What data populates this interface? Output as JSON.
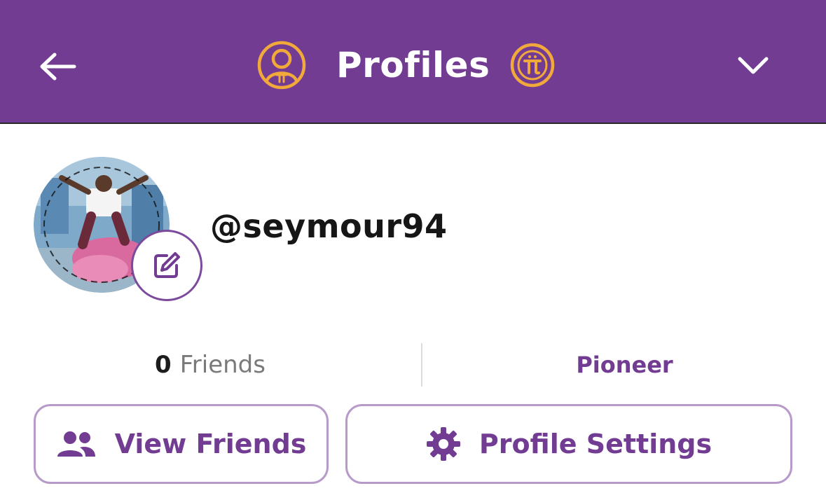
{
  "header": {
    "title": "Profiles",
    "background_color": "#713c92",
    "accent_color": "#f2a93b",
    "back_icon": "arrow-left-icon",
    "profile_icon": "profile-pi-icon",
    "coin_icon": "pi-coin-icon",
    "menu_icon": "chevron-down-icon"
  },
  "profile": {
    "username": "@seymour94",
    "avatar_icon": "avatar-image",
    "edit_icon": "edit-pencil-icon"
  },
  "stats": {
    "friends_count": "0",
    "friends_label": "Friends",
    "role": "Pioneer"
  },
  "actions": {
    "view_friends_label": "View Friends",
    "view_friends_icon": "friends-icon",
    "profile_settings_label": "Profile Settings",
    "profile_settings_icon": "gear-icon"
  }
}
